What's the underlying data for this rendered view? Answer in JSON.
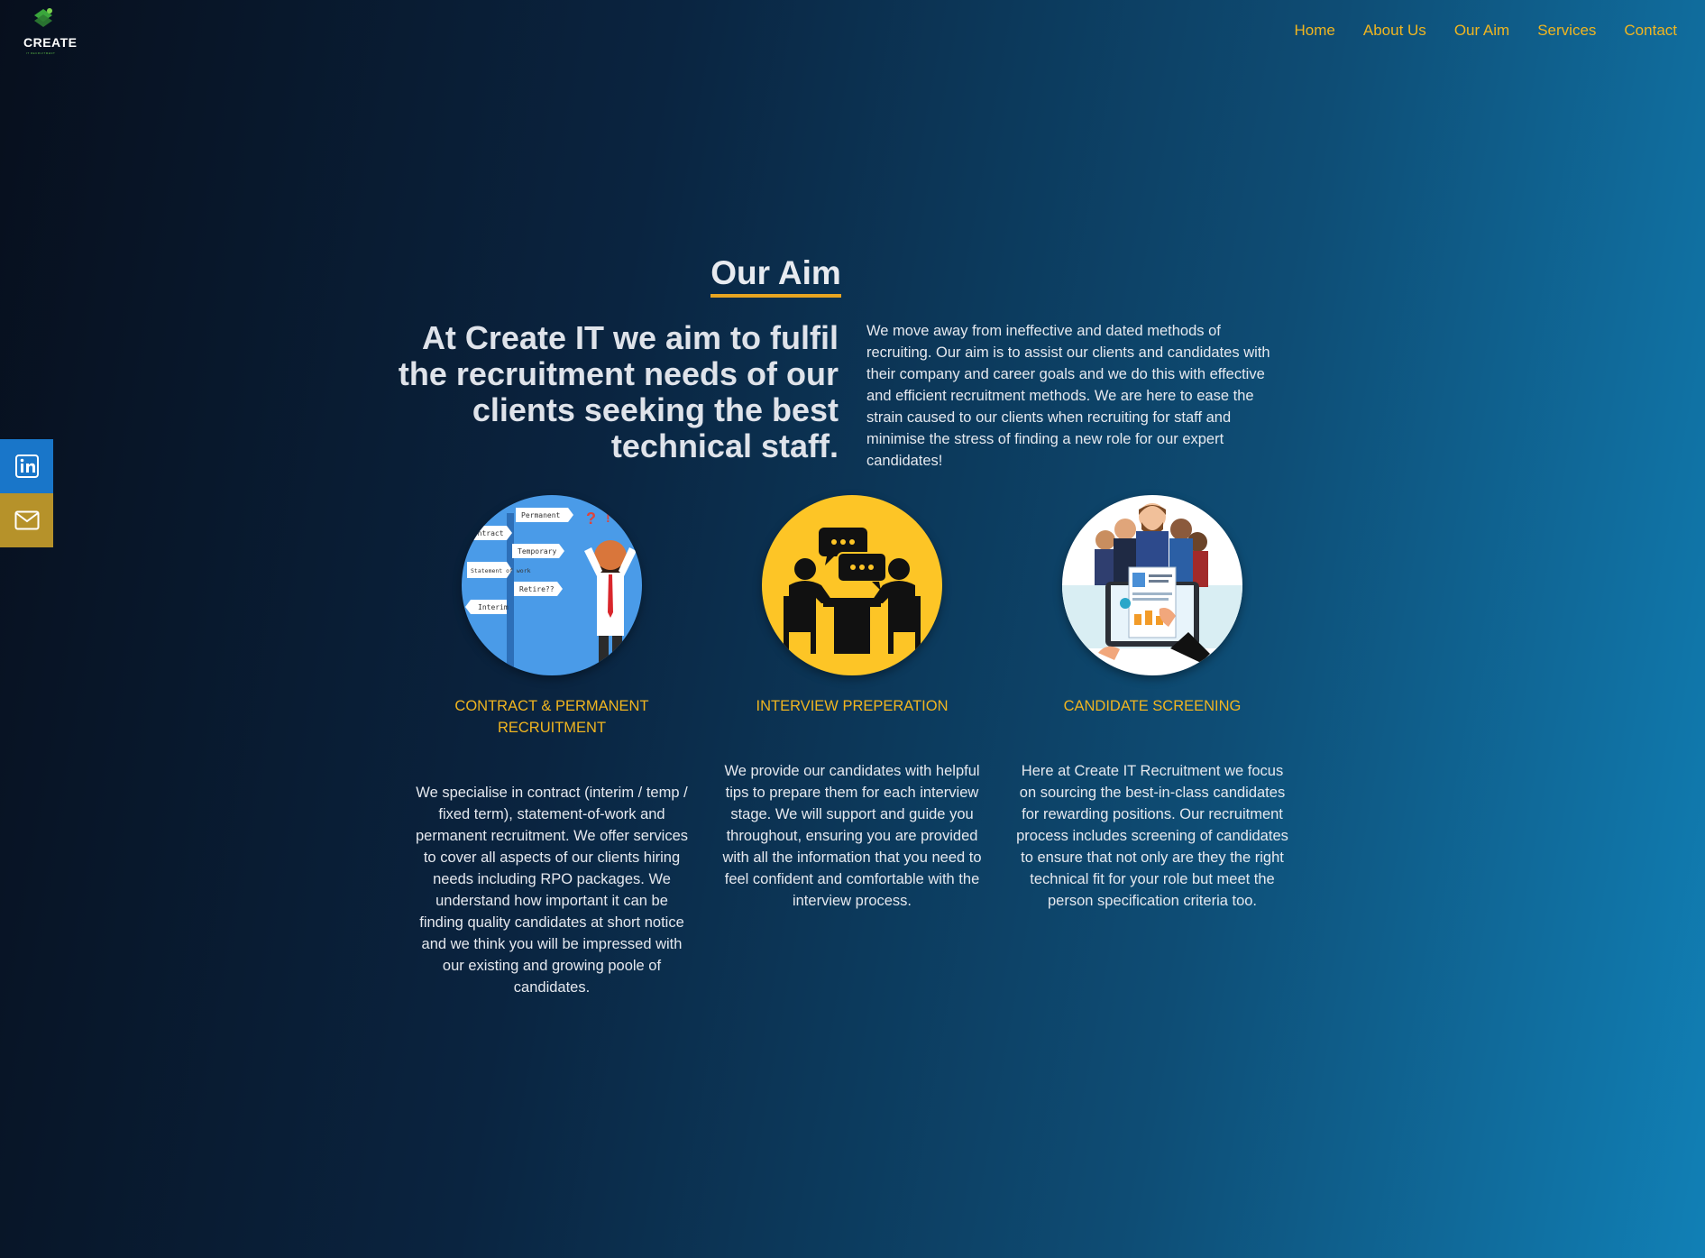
{
  "logo": {
    "word": "CREATE",
    "sub": "IT RECRUITMENT",
    "icon": "create-logo-icon"
  },
  "nav": {
    "items": [
      "Home",
      "About Us",
      "Our Aim",
      "Services",
      "Contact"
    ]
  },
  "social": {
    "linkedin_icon": "linkedin-icon",
    "mail_icon": "mail-icon"
  },
  "section": {
    "title": "Our Aim",
    "lead": "At Create IT we aim to fulfil the recruitment needs of our clients seeking the best technical staff.",
    "intro": "We move away from ineffective and dated methods of recruiting. Our aim is to assist our clients and candidates with their company and career goals and we do this with effective and efficient recruitment methods. We are here to ease the strain caused to our clients when recruiting for staff and minimise the stress of finding a new role for our expert candidates!"
  },
  "features": [
    {
      "heading": "CONTRACT & PERMANENT RECRUITMENT",
      "text": "We specialise in contract (interim / temp / fixed term), statement-of-work and permanent recruitment. We offer services to cover all aspects of our clients hiring needs including RPO packages. We understand how important it can be finding quality candidates at short notice and we think you will be impressed with our existing and growing poole of candidates.",
      "signs": [
        "Permanent",
        "Contract",
        "Temporary",
        "Statement of work",
        "Retire??",
        "Interim"
      ]
    },
    {
      "heading": "INTERVIEW PREPERATION",
      "text": "We provide our candidates with helpful tips to prepare them for each interview stage. We will support and guide you throughout, ensuring you are provided with all the information that you need to feel confident and comfortable with the interview process."
    },
    {
      "heading": "CANDIDATE SCREENING",
      "text": "Here at Create IT Recruitment we focus on sourcing the best-in-class candidates for rewarding positions. Our recruitment process includes screening of candidates to ensure that not only are they the right technical fit for your role but meet the person specification criteria too."
    }
  ],
  "colors": {
    "accent": "#f0b520",
    "linkedin": "#1976c9",
    "mail": "#b6922a"
  }
}
